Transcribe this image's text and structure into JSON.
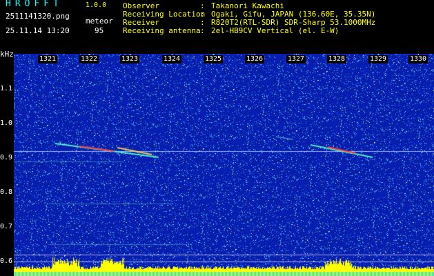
{
  "app": {
    "title": "HROFFT",
    "version": "1.0.0"
  },
  "capture": {
    "filename": "2511141320.png",
    "datetime": "25.11.14 13:20",
    "mode_label": "meteor",
    "mode_count": "95"
  },
  "info": [
    {
      "key": "Observer",
      "value": "Takanori Kawachi"
    },
    {
      "key": "Receiving Location",
      "value": "Ogaki, Gifu, JAPAN (136.60E, 35.35N)"
    },
    {
      "key": "Receiver",
      "value": "R820T2(RTL-SDR) SDR-Sharp 53.1000MHz"
    },
    {
      "key": "Receiving antenna",
      "value": "2el-HB9CV Vertical (el. E-W)"
    }
  ],
  "separator": ":",
  "axis": {
    "unit": "kHz",
    "y_ticks": [
      "1.1",
      "1.0",
      "0.9",
      "0.8",
      "0.7",
      "0.6"
    ],
    "x_ticks": [
      "1321",
      "1322",
      "1323",
      "1324",
      "1325",
      "1326",
      "1327",
      "1328",
      "1329",
      "1330"
    ]
  },
  "colors": {
    "background": "#000000",
    "waterfall_base": "#0a2aa8",
    "label_yellow": "#ffff00",
    "title_cyan": "#00ffff",
    "guide_line": "#c8c8ff",
    "meteor_trace": "#ff3030"
  }
}
